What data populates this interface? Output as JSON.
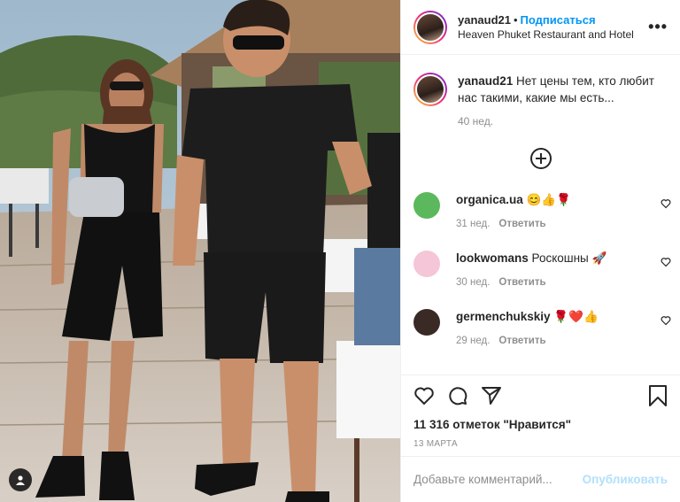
{
  "post": {
    "username": "yanaud21",
    "separator": "•",
    "follow_label": "Подписаться",
    "location": "Heaven Phuket Restaurant and Hotel",
    "more_icon": "more-icon",
    "caption": {
      "username": "yanaud21",
      "text": "Нет цены тем, кто любит нас такими, какие мы есть...",
      "time": "40 нед."
    },
    "load_more_icon": "plus-circle-icon",
    "comments": [
      {
        "username": "organica.ua",
        "text": "😊👍🌹",
        "time": "31 нед.",
        "reply_label": "Ответить",
        "avatar_color": "#5cb85c"
      },
      {
        "username": "lookwomans",
        "text": "Роскошны 🚀",
        "time": "30 нед.",
        "reply_label": "Ответить",
        "avatar_color": "#f4c6d7"
      },
      {
        "username": "germenchukskiy",
        "text": "🌹❤️👍",
        "time": "29 нед.",
        "reply_label": "Ответить",
        "avatar_color": "#3a2a25"
      }
    ],
    "likes": "11 316 отметок \"Нравится\"",
    "date": "13 МАРТА",
    "comment_placeholder": "Добавьте комментарий...",
    "publish_label": "Опубликовать",
    "colors": {
      "link_blue": "#0095f6",
      "publish_disabled": "#b2dffc",
      "muted": "#8e8e8e",
      "text": "#262626"
    }
  }
}
